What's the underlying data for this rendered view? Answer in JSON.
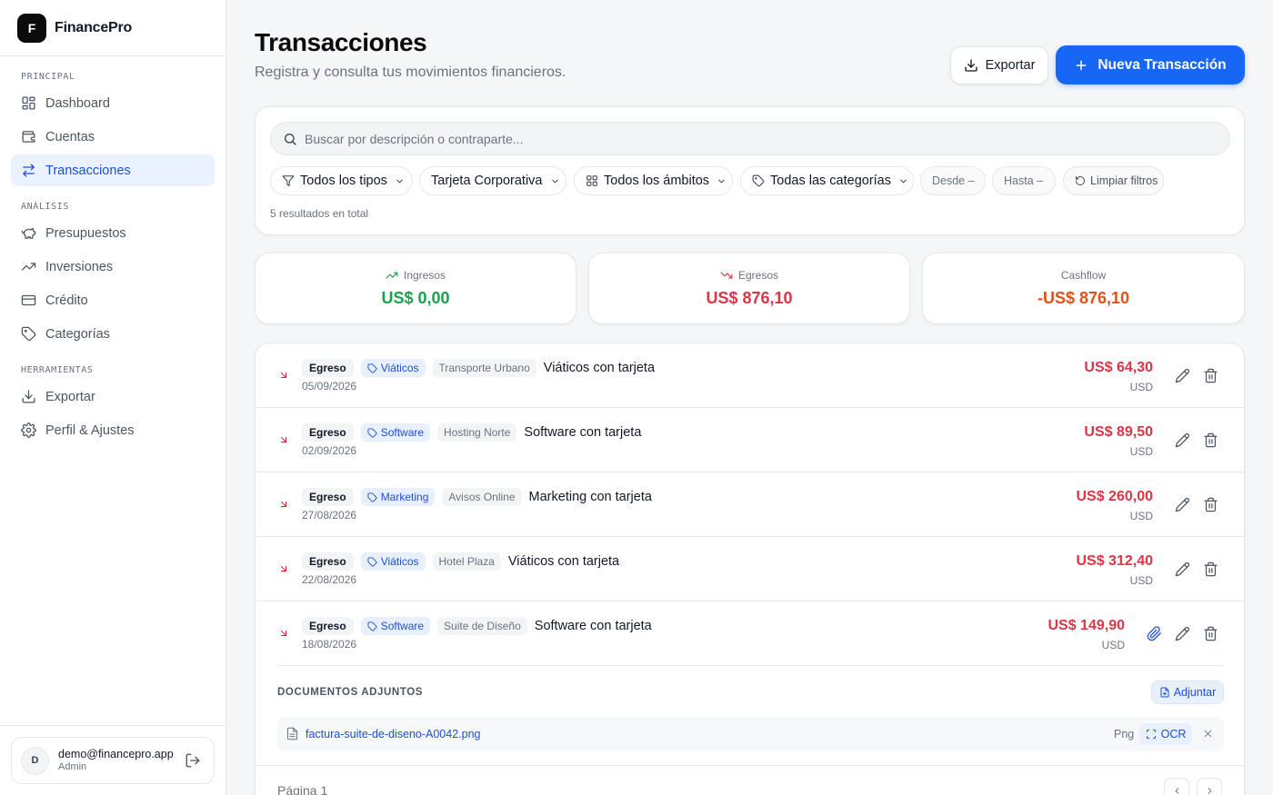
{
  "brand": {
    "logo_letter": "F",
    "name": "FinancePro"
  },
  "sidebar": {
    "sections": {
      "principal": "PRINCIPAL",
      "analisis": "ANÁLISIS",
      "herramientas": "HERRAMIENTAS"
    },
    "items": [
      {
        "label": "Dashboard",
        "icon": "dashboard-icon"
      },
      {
        "label": "Cuentas",
        "icon": "wallet-icon"
      },
      {
        "label": "Transacciones",
        "icon": "arrows-exchange-icon",
        "active": true
      },
      {
        "label": "Presupuestos",
        "icon": "piggy-bank-icon"
      },
      {
        "label": "Inversiones",
        "icon": "trending-up-icon"
      },
      {
        "label": "Crédito",
        "icon": "credit-card-icon"
      },
      {
        "label": "Categorías",
        "icon": "tag-icon"
      },
      {
        "label": "Exportar",
        "icon": "download-icon"
      },
      {
        "label": "Perfil & Ajustes",
        "icon": "gear-icon"
      }
    ]
  },
  "user": {
    "initial": "D",
    "email": "demo@financepro.app",
    "role": "Admin"
  },
  "header": {
    "title": "Transacciones",
    "subtitle": "Registra y consulta tus movimientos financieros.",
    "export_label": "Exportar",
    "new_label": "Nueva Transacción"
  },
  "filters": {
    "search_placeholder": "Buscar por descripción o contraparte...",
    "type": "Todos los tipos",
    "account": "Tarjeta Corporativa",
    "scope": "Todos los ámbitos",
    "category": "Todas las categorías",
    "from": "Desde –",
    "to": "Hasta –",
    "clear": "Limpiar filtros",
    "results": "5 resultados en total"
  },
  "stats": {
    "income": {
      "label": "Ingresos",
      "value": "US$ 0,00",
      "color": "#16a34a"
    },
    "expense": {
      "label": "Egresos",
      "value": "US$ 876,10",
      "color": "#dc3545"
    },
    "cashflow": {
      "label": "Cashflow",
      "value": "-US$ 876,10",
      "color": "#e0521a"
    }
  },
  "transactions": [
    {
      "type": "Egreso",
      "category": "Viáticos",
      "counterparty": "Transporte Urbano",
      "description": "Viáticos con tarjeta",
      "date": "05/09/2026",
      "amount": "US$ 64,30",
      "currency": "USD",
      "has_attachment": false
    },
    {
      "type": "Egreso",
      "category": "Software",
      "counterparty": "Hosting Norte",
      "description": "Software con tarjeta",
      "date": "02/09/2026",
      "amount": "US$ 89,50",
      "currency": "USD",
      "has_attachment": false
    },
    {
      "type": "Egreso",
      "category": "Marketing",
      "counterparty": "Avisos Online",
      "description": "Marketing con tarjeta",
      "date": "27/08/2026",
      "amount": "US$ 260,00",
      "currency": "USD",
      "has_attachment": false
    },
    {
      "type": "Egreso",
      "category": "Viáticos",
      "counterparty": "Hotel Plaza",
      "description": "Viáticos con tarjeta",
      "date": "22/08/2026",
      "amount": "US$ 312,40",
      "currency": "USD",
      "has_attachment": false
    },
    {
      "type": "Egreso",
      "category": "Software",
      "counterparty": "Suite de Diseño",
      "description": "Software con tarjeta",
      "date": "18/08/2026",
      "amount": "US$ 149,90",
      "currency": "USD",
      "has_attachment": true
    }
  ],
  "documents": {
    "title": "DOCUMENTOS ADJUNTOS",
    "attach_label": "Adjuntar",
    "files": [
      {
        "name": "factura-suite-de-diseno-A0042.png",
        "type": "Png",
        "ocr_label": "OCR"
      }
    ]
  },
  "pagination": {
    "label": "Página 1"
  }
}
